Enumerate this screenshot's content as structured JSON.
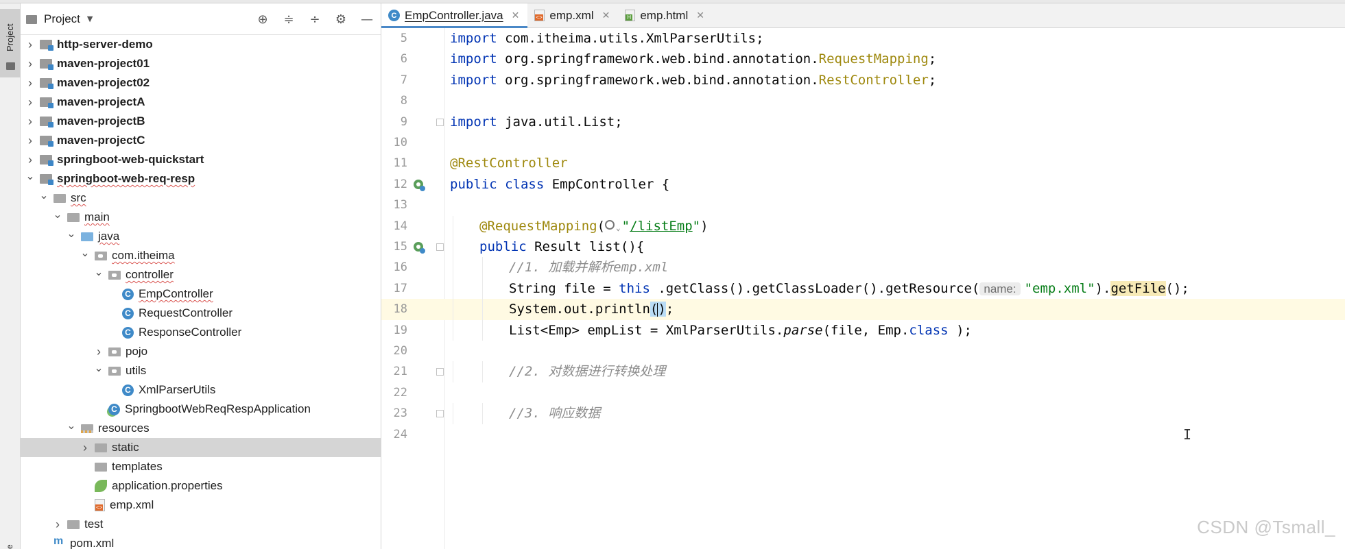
{
  "panel": {
    "title": "Project",
    "tools": [
      "target-icon",
      "expand-all-icon",
      "collapse-all-icon",
      "gear-icon",
      "minimize-icon"
    ]
  },
  "toolstrip": {
    "project_tab": "Project",
    "bottom_label": "re"
  },
  "tree": [
    {
      "label": "http-server-demo",
      "depth": 0,
      "arrow": "right",
      "icon": "module-icon",
      "bold": true,
      "squiggle": false
    },
    {
      "label": "maven-project01",
      "depth": 0,
      "arrow": "right",
      "icon": "module-icon",
      "bold": true,
      "squiggle": false
    },
    {
      "label": "maven-project02",
      "depth": 0,
      "arrow": "right",
      "icon": "module-icon",
      "bold": true,
      "squiggle": false
    },
    {
      "label": "maven-projectA",
      "depth": 0,
      "arrow": "right",
      "icon": "module-icon",
      "bold": true,
      "squiggle": false
    },
    {
      "label": "maven-projectB",
      "depth": 0,
      "arrow": "right",
      "icon": "module-icon",
      "bold": true,
      "squiggle": false
    },
    {
      "label": "maven-projectC",
      "depth": 0,
      "arrow": "right",
      "icon": "module-icon",
      "bold": true,
      "squiggle": false
    },
    {
      "label": "springboot-web-quickstart",
      "depth": 0,
      "arrow": "right",
      "icon": "module-icon",
      "bold": true,
      "squiggle": false
    },
    {
      "label": "springboot-web-req-resp",
      "depth": 0,
      "arrow": "down",
      "icon": "module-icon",
      "bold": true,
      "squiggle": true
    },
    {
      "label": "src",
      "depth": 1,
      "arrow": "down",
      "icon": "folder-icon",
      "bold": false,
      "squiggle": true
    },
    {
      "label": "main",
      "depth": 2,
      "arrow": "down",
      "icon": "folder-icon",
      "bold": false,
      "squiggle": true
    },
    {
      "label": "java",
      "depth": 3,
      "arrow": "down",
      "icon": "source-folder-icon",
      "bold": false,
      "squiggle": true
    },
    {
      "label": "com.itheima",
      "depth": 4,
      "arrow": "down",
      "icon": "package-icon",
      "bold": false,
      "squiggle": true
    },
    {
      "label": "controller",
      "depth": 5,
      "arrow": "down",
      "icon": "package-icon",
      "bold": false,
      "squiggle": true
    },
    {
      "label": "EmpController",
      "depth": 6,
      "arrow": "none",
      "icon": "class-icon",
      "bold": false,
      "squiggle": true
    },
    {
      "label": "RequestController",
      "depth": 6,
      "arrow": "none",
      "icon": "class-icon",
      "bold": false,
      "squiggle": false
    },
    {
      "label": "ResponseController",
      "depth": 6,
      "arrow": "none",
      "icon": "class-icon",
      "bold": false,
      "squiggle": false
    },
    {
      "label": "pojo",
      "depth": 5,
      "arrow": "right",
      "icon": "package-icon",
      "bold": false,
      "squiggle": false
    },
    {
      "label": "utils",
      "depth": 5,
      "arrow": "down",
      "icon": "package-icon",
      "bold": false,
      "squiggle": false
    },
    {
      "label": "XmlParserUtils",
      "depth": 6,
      "arrow": "none",
      "icon": "class-icon",
      "bold": false,
      "squiggle": false
    },
    {
      "label": "SpringbootWebReqRespApplication",
      "depth": 5,
      "arrow": "none",
      "icon": "spring-class-icon",
      "bold": false,
      "squiggle": false
    },
    {
      "label": "resources",
      "depth": 3,
      "arrow": "down",
      "icon": "resources-folder-icon",
      "bold": false,
      "squiggle": false
    },
    {
      "label": "static",
      "depth": 4,
      "arrow": "right",
      "icon": "folder-icon",
      "bold": false,
      "squiggle": false,
      "selected": true
    },
    {
      "label": "templates",
      "depth": 4,
      "arrow": "none",
      "icon": "folder-icon",
      "bold": false,
      "squiggle": false
    },
    {
      "label": "application.properties",
      "depth": 4,
      "arrow": "none",
      "icon": "spring-leaf-icon",
      "bold": false,
      "squiggle": false
    },
    {
      "label": "emp.xml",
      "depth": 4,
      "arrow": "none",
      "icon": "xml-file-icon",
      "bold": false,
      "squiggle": false
    },
    {
      "label": "test",
      "depth": 2,
      "arrow": "right",
      "icon": "folder-icon",
      "bold": false,
      "squiggle": false
    },
    {
      "label": "pom.xml",
      "depth": 1,
      "arrow": "none",
      "icon": "maven-file-icon",
      "bold": false,
      "squiggle": false
    }
  ],
  "tabs": [
    {
      "label": "EmpController.java",
      "icon": "java-class-icon",
      "active": true
    },
    {
      "label": "emp.xml",
      "icon": "xml-file-icon",
      "active": false
    },
    {
      "label": "emp.html",
      "icon": "html-file-icon",
      "active": false
    }
  ],
  "editor": {
    "current_line": "18",
    "lines": [
      {
        "num": "5",
        "indent": 0,
        "gutter_icon": "",
        "fold": false,
        "tokens": [
          [
            "kw",
            "import"
          ],
          [
            "",
            "com.itheima.utils.XmlParserUtils;"
          ]
        ]
      },
      {
        "num": "6",
        "indent": 0,
        "gutter_icon": "",
        "fold": false,
        "tokens": [
          [
            "kw",
            "import"
          ],
          [
            "",
            "org.springframework.web.bind.annotation."
          ],
          [
            "ann",
            "RequestMapping"
          ],
          [
            "",
            ";"
          ]
        ]
      },
      {
        "num": "7",
        "indent": 0,
        "gutter_icon": "",
        "fold": false,
        "tokens": [
          [
            "kw",
            "import"
          ],
          [
            "",
            "org.springframework.web.bind.annotation."
          ],
          [
            "ann",
            "RestController"
          ],
          [
            "",
            ";"
          ]
        ]
      },
      {
        "num": "8",
        "indent": 0,
        "gutter_icon": "",
        "fold": false,
        "tokens": []
      },
      {
        "num": "9",
        "indent": 0,
        "gutter_icon": "",
        "fold": true,
        "tokens": [
          [
            "kw",
            "import"
          ],
          [
            "",
            "java.util.List;"
          ]
        ]
      },
      {
        "num": "10",
        "indent": 0,
        "gutter_icon": "",
        "fold": false,
        "tokens": []
      },
      {
        "num": "11",
        "indent": 0,
        "gutter_icon": "",
        "fold": false,
        "tokens": [
          [
            "ann",
            "@RestController"
          ]
        ]
      },
      {
        "num": "12",
        "indent": 0,
        "gutter_icon": "bean-icon",
        "fold": false,
        "tokens": [
          [
            "kw",
            "public"
          ],
          [
            "kw",
            "class"
          ],
          [
            "",
            "EmpController {"
          ]
        ]
      },
      {
        "num": "13",
        "indent": 0,
        "gutter_icon": "",
        "fold": false,
        "tokens": []
      },
      {
        "num": "14",
        "indent": 1,
        "gutter_icon": "",
        "fold": false,
        "tokens": [
          [
            "ann",
            "@RequestMapping"
          ],
          [
            "",
            "("
          ],
          [
            "inlay",
            ""
          ],
          [
            "str",
            "\""
          ],
          [
            "link",
            "/listEmp"
          ],
          [
            "str",
            "\""
          ],
          [
            "",
            ")"
          ]
        ]
      },
      {
        "num": "15",
        "indent": 1,
        "gutter_icon": "bean-icon",
        "fold": true,
        "tokens": [
          [
            "kw",
            "public"
          ],
          [
            "",
            "Result list(){"
          ]
        ]
      },
      {
        "num": "16",
        "indent": 2,
        "gutter_icon": "",
        "fold": false,
        "tokens": [
          [
            "cmt",
            "//1. 加载并解析emp.xml"
          ]
        ]
      },
      {
        "num": "17",
        "indent": 2,
        "gutter_icon": "",
        "fold": false,
        "tokens": [
          [
            "",
            "String file = "
          ],
          [
            "kw",
            "this"
          ],
          [
            "",
            ".getClass().getClassLoader().getResource("
          ],
          [
            "hint",
            "name:"
          ],
          [
            "str",
            "\"emp.xml\""
          ],
          [
            "",
            ")."
          ],
          [
            "hl",
            "getFile"
          ],
          [
            "",
            "();"
          ]
        ]
      },
      {
        "num": "18",
        "indent": 2,
        "gutter_icon": "",
        "fold": false,
        "tokens": [
          [
            "",
            "System.out.println"
          ],
          [
            "cursor",
            "()"
          ],
          [
            "",
            ";"
          ]
        ]
      },
      {
        "num": "19",
        "indent": 2,
        "gutter_icon": "",
        "fold": false,
        "tokens": [
          [
            "",
            "List<Emp> empList = XmlParserUtils."
          ],
          [
            "it",
            "parse"
          ],
          [
            "",
            "(file, Emp."
          ],
          [
            "kw",
            "class"
          ],
          [
            "",
            ");"
          ]
        ]
      },
      {
        "num": "20",
        "indent": 0,
        "gutter_icon": "",
        "fold": false,
        "tokens": []
      },
      {
        "num": "21",
        "indent": 2,
        "gutter_icon": "",
        "fold": true,
        "tokens": [
          [
            "cmt",
            "//2. 对数据进行转换处理"
          ]
        ]
      },
      {
        "num": "22",
        "indent": 0,
        "gutter_icon": "",
        "fold": false,
        "tokens": []
      },
      {
        "num": "23",
        "indent": 2,
        "gutter_icon": "",
        "fold": true,
        "tokens": [
          [
            "cmt",
            "//3. 响应数据"
          ]
        ]
      },
      {
        "num": "24",
        "indent": 0,
        "gutter_icon": "",
        "fold": false,
        "tokens": []
      }
    ]
  },
  "watermark": "CSDN @Tsmall_",
  "colors": {
    "keyword": "#0033b3",
    "annotation": "#9e880d",
    "comment": "#8c8c8c",
    "string": "#067d17",
    "accent": "#4a88c7"
  }
}
